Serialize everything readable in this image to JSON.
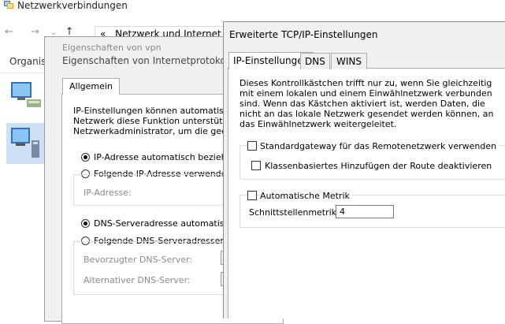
{
  "explorer": {
    "title": "Netzwerkverbindungen",
    "nav_back": "←",
    "nav_forward": "→",
    "nav_down": "⌄",
    "nav_up": "↑",
    "breadcrumb_sep": "«",
    "breadcrumb_1": "Netzwerk und Internet",
    "breadcrumb_arrow": "›",
    "organize": "Organisi"
  },
  "props_dialog": {
    "title": "Eigenschaften von vpn",
    "subtitle": "Eigenschaften von Internetprotokoll, V",
    "tab": "Allgemein",
    "intro_1": "IP-Einstellungen können automatisch zu",
    "intro_2": "Netzwerk diese Funktion unterstützt. We",
    "intro_3": "Netzwerkadministrator, um die geeignete",
    "radio_ip_auto": "IP-Adresse automatisch beziehen",
    "radio_ip_manual": "Folgende IP-Adresse verwenden:",
    "ip_label": "IP-Adresse:",
    "radio_dns_auto": "DNS-Serveradresse automatisch b",
    "radio_dns_manual": "Folgende DNS-Serveradressen ver",
    "dns_pref": "Bevorzugter DNS-Server:",
    "dns_alt": "Alternativer DNS-Server:"
  },
  "advanced_dialog": {
    "title": "Erweiterte TCP/IP-Einstellungen",
    "tabs": [
      "IP-Einstellungen",
      "DNS",
      "WINS"
    ],
    "info_text": "Dieses Kontrollkästchen trifft nur zu, wenn Sie gleichzeitig mit einem lokalen und einem Einwählnetzwerk verbunden sind. Wenn das Kästchen aktiviert ist, werden Daten, die nicht an das lokale Netzwerk gesendet werden können, an das Einwählnetzwerk weitergeleitet.",
    "chk_gateway": "Standardgateway für das Remotenetzwerk verwenden",
    "chk_class": "Klassenbasiertes Hinzufügen der Route deaktivieren",
    "chk_metric": "Automatische Metrik",
    "metric_label": "Schnittstellenmetrik:",
    "metric_value": "4"
  }
}
